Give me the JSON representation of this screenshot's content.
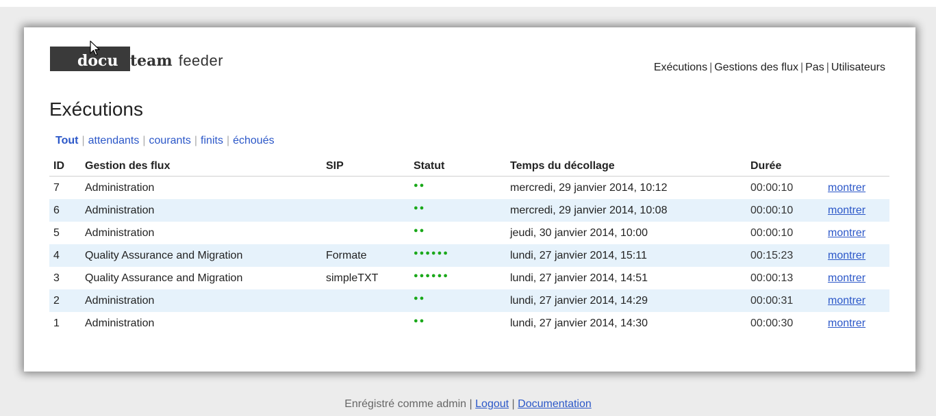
{
  "logo": {
    "part1": "docu",
    "part2": "team",
    "part3": "feeder"
  },
  "topnav": [
    {
      "label": "Exécutions"
    },
    {
      "label": "Gestions des flux"
    },
    {
      "label": "Pas"
    },
    {
      "label": "Utilisateurs"
    }
  ],
  "page_title": "Exécutions",
  "filters": [
    {
      "label": "Tout",
      "active": true
    },
    {
      "label": "attendants",
      "active": false
    },
    {
      "label": "courants",
      "active": false
    },
    {
      "label": "finits",
      "active": false
    },
    {
      "label": "échoués",
      "active": false
    }
  ],
  "table": {
    "headers": {
      "id": "ID",
      "flux": "Gestion des flux",
      "sip": "SIP",
      "statut": "Statut",
      "temps": "Temps du décollage",
      "duree": "Durée"
    },
    "rows": [
      {
        "id": "7",
        "flux": "Administration",
        "sip": "",
        "dots": "●●",
        "temps": "mercredi, 29 janvier 2014, 10:12",
        "duree": "00:00:10",
        "action": "montrer"
      },
      {
        "id": "6",
        "flux": "Administration",
        "sip": "",
        "dots": "●●",
        "temps": "mercredi, 29 janvier 2014, 10:08",
        "duree": "00:00:10",
        "action": "montrer"
      },
      {
        "id": "5",
        "flux": "Administration",
        "sip": "",
        "dots": "●●",
        "temps": "jeudi, 30 janvier 2014, 10:00",
        "duree": "00:00:10",
        "action": "montrer"
      },
      {
        "id": "4",
        "flux": "Quality Assurance and Migration",
        "sip": "Formate",
        "dots": "●●●●●●",
        "temps": "lundi, 27 janvier 2014, 15:11",
        "duree": "00:15:23",
        "action": "montrer"
      },
      {
        "id": "3",
        "flux": "Quality Assurance and Migration",
        "sip": "simpleTXT",
        "dots": "●●●●●●",
        "temps": "lundi, 27 janvier 2014, 14:51",
        "duree": "00:00:13",
        "action": "montrer"
      },
      {
        "id": "2",
        "flux": "Administration",
        "sip": "",
        "dots": "●●",
        "temps": "lundi, 27 janvier 2014, 14:29",
        "duree": "00:00:31",
        "action": "montrer"
      },
      {
        "id": "1",
        "flux": "Administration",
        "sip": "",
        "dots": "●●",
        "temps": "lundi, 27 janvier 2014, 14:30",
        "duree": "00:00:30",
        "action": "montrer"
      }
    ]
  },
  "footer": {
    "text": "Enrégistré comme admin |",
    "logout": "Logout",
    "sep": "|",
    "docs": "Documentation"
  },
  "colors": {
    "link": "#2b57c8",
    "status_dot": "#1aa81a",
    "row_alt": "#e6f2fb",
    "logo_bg": "#3a3a3a"
  }
}
